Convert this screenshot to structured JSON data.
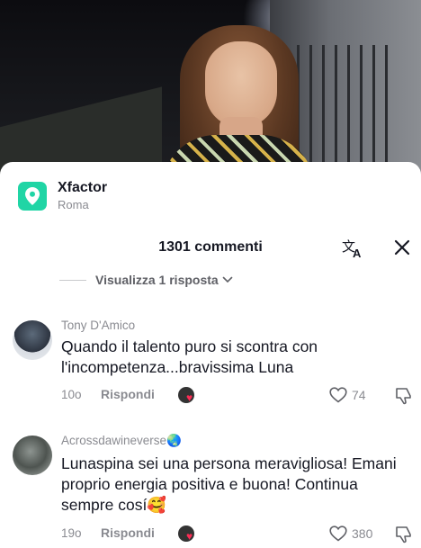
{
  "place": {
    "title": "Xfactor",
    "subtitle": "Roma",
    "icon": "location-pin-icon",
    "color": "#20d5a5"
  },
  "comments_header": {
    "count_label": "1301 commenti",
    "translate_icon": "translate-icon",
    "close_icon": "close-icon"
  },
  "view_replies": {
    "label": "Visualizza 1 risposta",
    "icon": "chevron-down-icon"
  },
  "comments": [
    {
      "author": "Tony D'Amico",
      "text": "Quando il talento puro si scontra con l'incompetenza...bravissima Luna",
      "time": "10o",
      "reply_label": "Rispondi",
      "likes": "74"
    },
    {
      "author": "Acrossdawineverse",
      "author_emoji": "🌏",
      "text": "Lunaspina sei una persona meravigliosa! Emani proprio energia positiva e buona! Continua sempre cosí",
      "text_emoji": "🥰",
      "time": "19o",
      "reply_label": "Rispondi",
      "likes": "380"
    }
  ],
  "colors": {
    "accent_like": "#fe2c55",
    "muted": "#8a8b91",
    "text": "#161823"
  }
}
